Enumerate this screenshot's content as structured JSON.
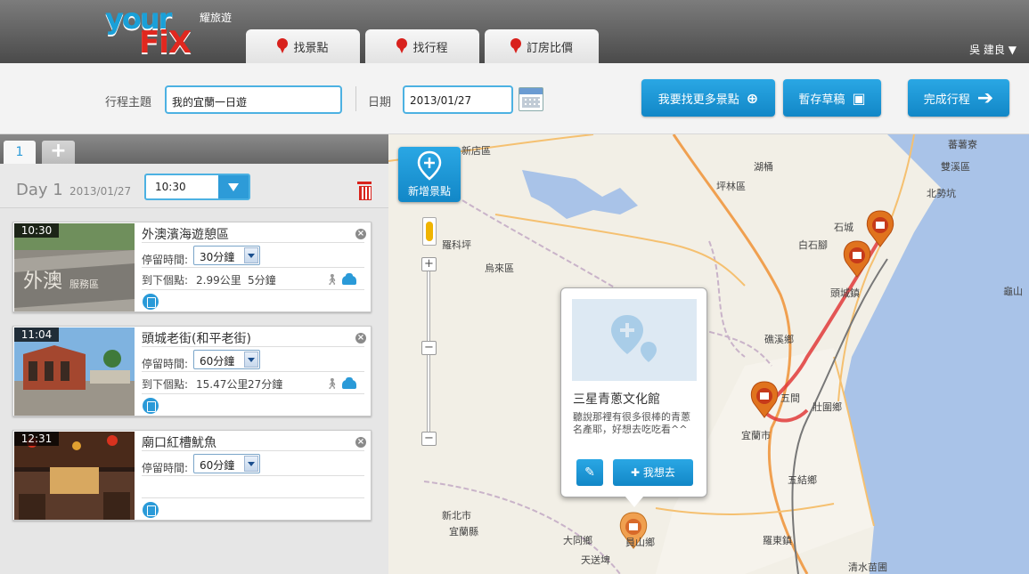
{
  "header": {
    "logo_your": "your",
    "logo_fix": "FiX",
    "logo_sub": "耀旅遊",
    "tabs": [
      {
        "label": "找景點"
      },
      {
        "label": "找行程"
      },
      {
        "label": "訂房比價"
      }
    ],
    "user": "吳 建良"
  },
  "toolbar": {
    "theme_label": "行程主題",
    "theme_value": "我的宜蘭一日遊",
    "date_label": "日期",
    "date_value": "2013/01/27",
    "find_more": "我要找更多景點",
    "save_draft": "暫存草稿",
    "finish": "完成行程"
  },
  "itinerary": {
    "day_tab": "1",
    "add_tab": "+",
    "day_name": "Day 1",
    "day_date": "2013/01/27",
    "start_time": "10:30",
    "stay_label": "停留時間:",
    "next_label": "到下個點:",
    "items": [
      {
        "time": "10:30",
        "title": "外澳濱海遊憩區",
        "stay": "30分鐘",
        "distance": "2.99公里",
        "duration": "5分鐘"
      },
      {
        "time": "11:04",
        "title": "頭城老街(和平老街)",
        "stay": "60分鐘",
        "distance": "15.47公里",
        "duration": "27分鐘"
      },
      {
        "time": "12:31",
        "title": "廟口紅槽魷魚",
        "stay": "60分鐘",
        "distance": "",
        "duration": ""
      }
    ]
  },
  "map": {
    "add_spot": "新增景點",
    "popup": {
      "title": "三星青蔥文化館",
      "desc": "聽說那裡有很多很棒的青蔥名產耶，好想去吃吃看^^",
      "want": "我想去"
    },
    "places": [
      {
        "name": "新店區"
      },
      {
        "name": "坪林區"
      },
      {
        "name": "湖桶"
      },
      {
        "name": "蕃薯寮"
      },
      {
        "name": "雙溪區"
      },
      {
        "name": "北勢坑"
      },
      {
        "name": "白石腳"
      },
      {
        "name": "石城"
      },
      {
        "name": "羅科坪"
      },
      {
        "name": "烏來區"
      },
      {
        "name": "頭城鎮"
      },
      {
        "name": "礁溪鄉"
      },
      {
        "name": "壯圍鄉"
      },
      {
        "name": "宜蘭市"
      },
      {
        "name": "五結鄉"
      },
      {
        "name": "羅東鎮"
      },
      {
        "name": "大同鄉"
      },
      {
        "name": "天送埤"
      },
      {
        "name": "員山鄉"
      },
      {
        "name": "新北市"
      },
      {
        "name": "宜蘭縣"
      },
      {
        "name": "清水苗圃"
      },
      {
        "name": "五間"
      },
      {
        "name": "龜山"
      }
    ]
  }
}
